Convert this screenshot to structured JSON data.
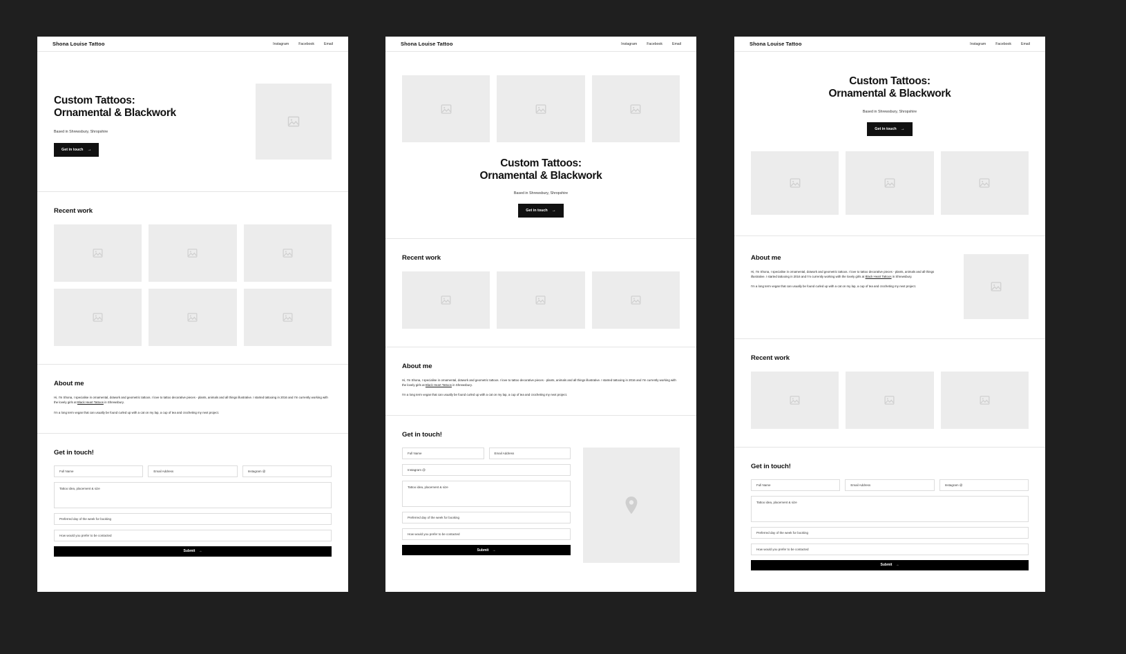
{
  "site": {
    "brand": "Shona Louise Tattoo",
    "nav": [
      {
        "label": "Instagram"
      },
      {
        "label": "Facebook"
      },
      {
        "label": "Email"
      }
    ]
  },
  "hero": {
    "title_line1": "Custom Tattoos:",
    "title_line2": "Ornamental & Blackwork",
    "subtitle": "Based in Shrewsbury, Shropshire",
    "cta_label": "Get in touch",
    "cta_arrow": "→"
  },
  "recent_work": {
    "heading": "Recent work",
    "image_count_desktop": 6,
    "image_count_tablet": 3,
    "image_count_mobile": 3
  },
  "about": {
    "heading": "About me",
    "paragraph1_part1": "Hi, I'm Shona, I specialise in ornamental, dotwork and geometric tattoos. I love to tattoo decorative pieces - plants, animals and all things illustrative. I started tattooing in 2016 and I'm currently working with the lovely girls at ",
    "paragraph1_link": "Black Heart Tattoos",
    "paragraph1_part2": " in Shrewsbury.",
    "paragraph2": "I'm a long term vegan that can usually be found curled up with a cat on my lap, a cup of tea and crocheting my next project."
  },
  "contact": {
    "heading": "Get in touch!",
    "fields": {
      "full_name": "Full Name",
      "email": "Email Address",
      "instagram": "Instagram @",
      "tattoo_idea": "Tattoo idea, placement & size",
      "preferred_day": "Preferred day of the week for booking",
      "contact_method": "How would you prefer to be contacted"
    },
    "submit_label": "Submit",
    "submit_arrow": "→"
  },
  "colors": {
    "page_background": "#1f1f1f",
    "panel_background": "#ffffff",
    "accent_dark": "#111111",
    "placeholder_grey": "#ececec",
    "border_grey": "#e4e4e4"
  },
  "icons": {
    "image_placeholder": "image-placeholder-icon",
    "map_pin": "map-pin-icon"
  }
}
